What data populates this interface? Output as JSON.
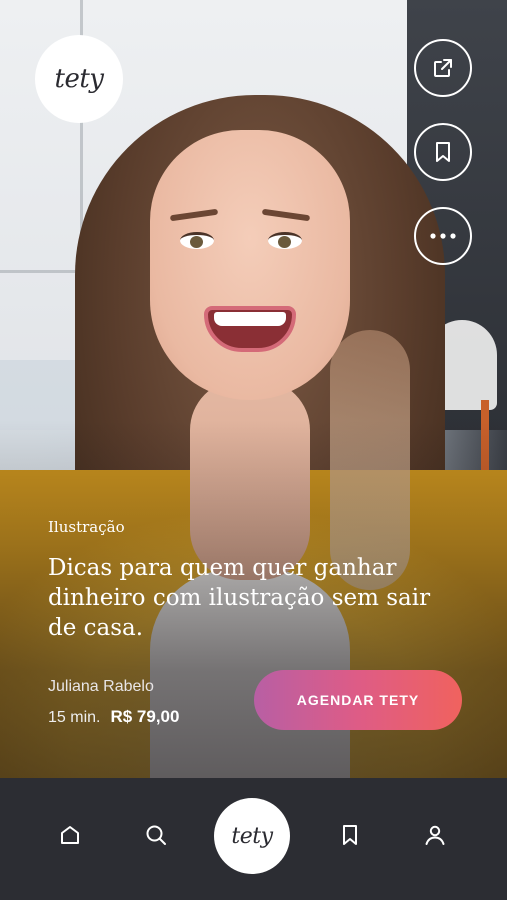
{
  "brand": {
    "logo_text": "tety"
  },
  "side_actions": [
    {
      "icon": "share-icon"
    },
    {
      "icon": "bookmark-icon"
    },
    {
      "icon": "more-icon"
    }
  ],
  "content": {
    "category": "Ilustração",
    "title": "Dicas para quem quer ganhar dinheiro com ilustração sem sair de casa.",
    "author": "Juliana Rabelo",
    "duration": "15 min.",
    "price": "R$ 79,00",
    "cta_label": "AGENDAR TETY"
  },
  "nav": {
    "items": [
      "home-icon",
      "search-icon",
      "tety-logo",
      "bookmark-icon",
      "profile-icon"
    ],
    "logo_text": "tety"
  },
  "colors": {
    "nav_bg": "#2c2d33",
    "cta_gradient_start": "#b85fa4",
    "cta_gradient_end": "#f0625e"
  }
}
